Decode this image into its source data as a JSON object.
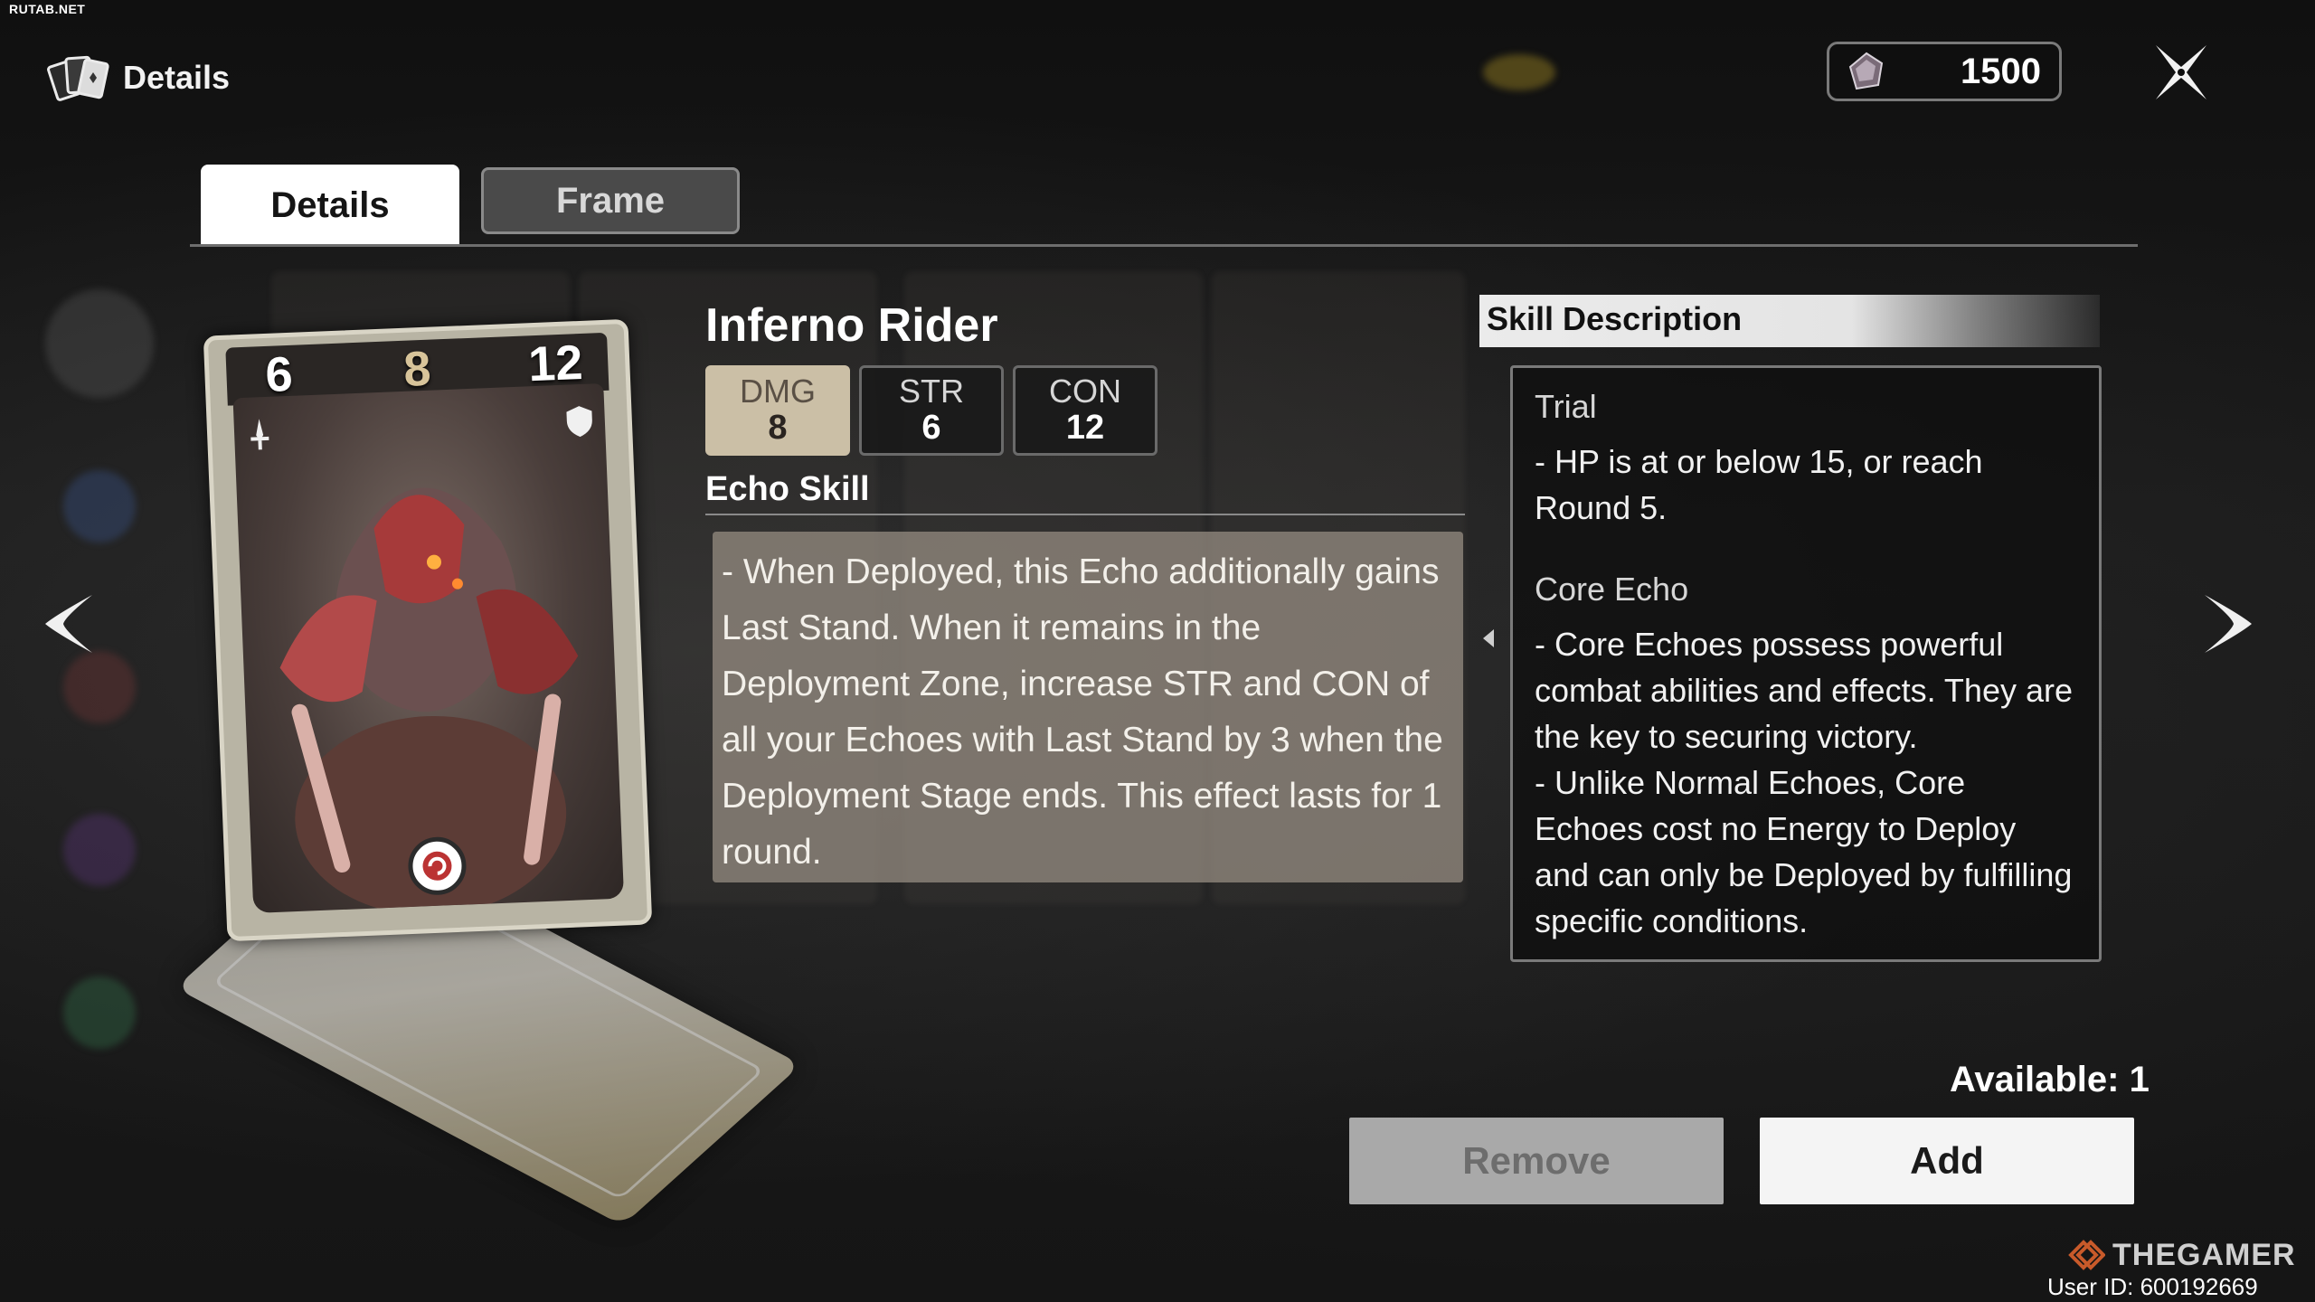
{
  "watermark": "RUTAB.NET",
  "header": {
    "title": "Details",
    "icon": "cards-icon"
  },
  "currency": {
    "value": "1500",
    "icon": "crystal-icon"
  },
  "tabs": [
    {
      "label": "Details",
      "active": true
    },
    {
      "label": "Frame",
      "active": false
    }
  ],
  "card": {
    "left": "6",
    "mid": "8",
    "right": "12"
  },
  "echo": {
    "name": "Inferno Rider",
    "stats": [
      {
        "label": "DMG",
        "value": "8",
        "active": true
      },
      {
        "label": "STR",
        "value": "6",
        "active": false
      },
      {
        "label": "CON",
        "value": "12",
        "active": false
      }
    ],
    "skill_title": "Echo Skill",
    "skill_text": "- When Deployed, this Echo additionally gains Last Stand. When it remains in the Deployment Zone, increase STR and CON of all your Echoes with Last Stand by 3 when the Deployment Stage ends. This effect lasts for 1 round."
  },
  "skill_description": {
    "title": "Skill Description",
    "trial_heading": "Trial",
    "trial_text": "- HP is at or below 15, or reach Round 5.",
    "core_heading": "Core Echo",
    "core_text_1": "- Core Echoes possess powerful combat abilities and effects. They are the key to securing victory.",
    "core_text_2": "- Unlike Normal Echoes, Core Echoes cost no Energy to Deploy and can only be Deployed by fulfilling specific conditions."
  },
  "available": "Available: 1",
  "buttons": {
    "remove": "Remove",
    "add": "Add"
  },
  "brand": "THEGAMER",
  "user_id": "User ID: 600192669",
  "colors": {
    "accent_stat": "#cbbfa6",
    "add_button": "#f4f4f4",
    "remove_button": "#a9a9a9"
  }
}
